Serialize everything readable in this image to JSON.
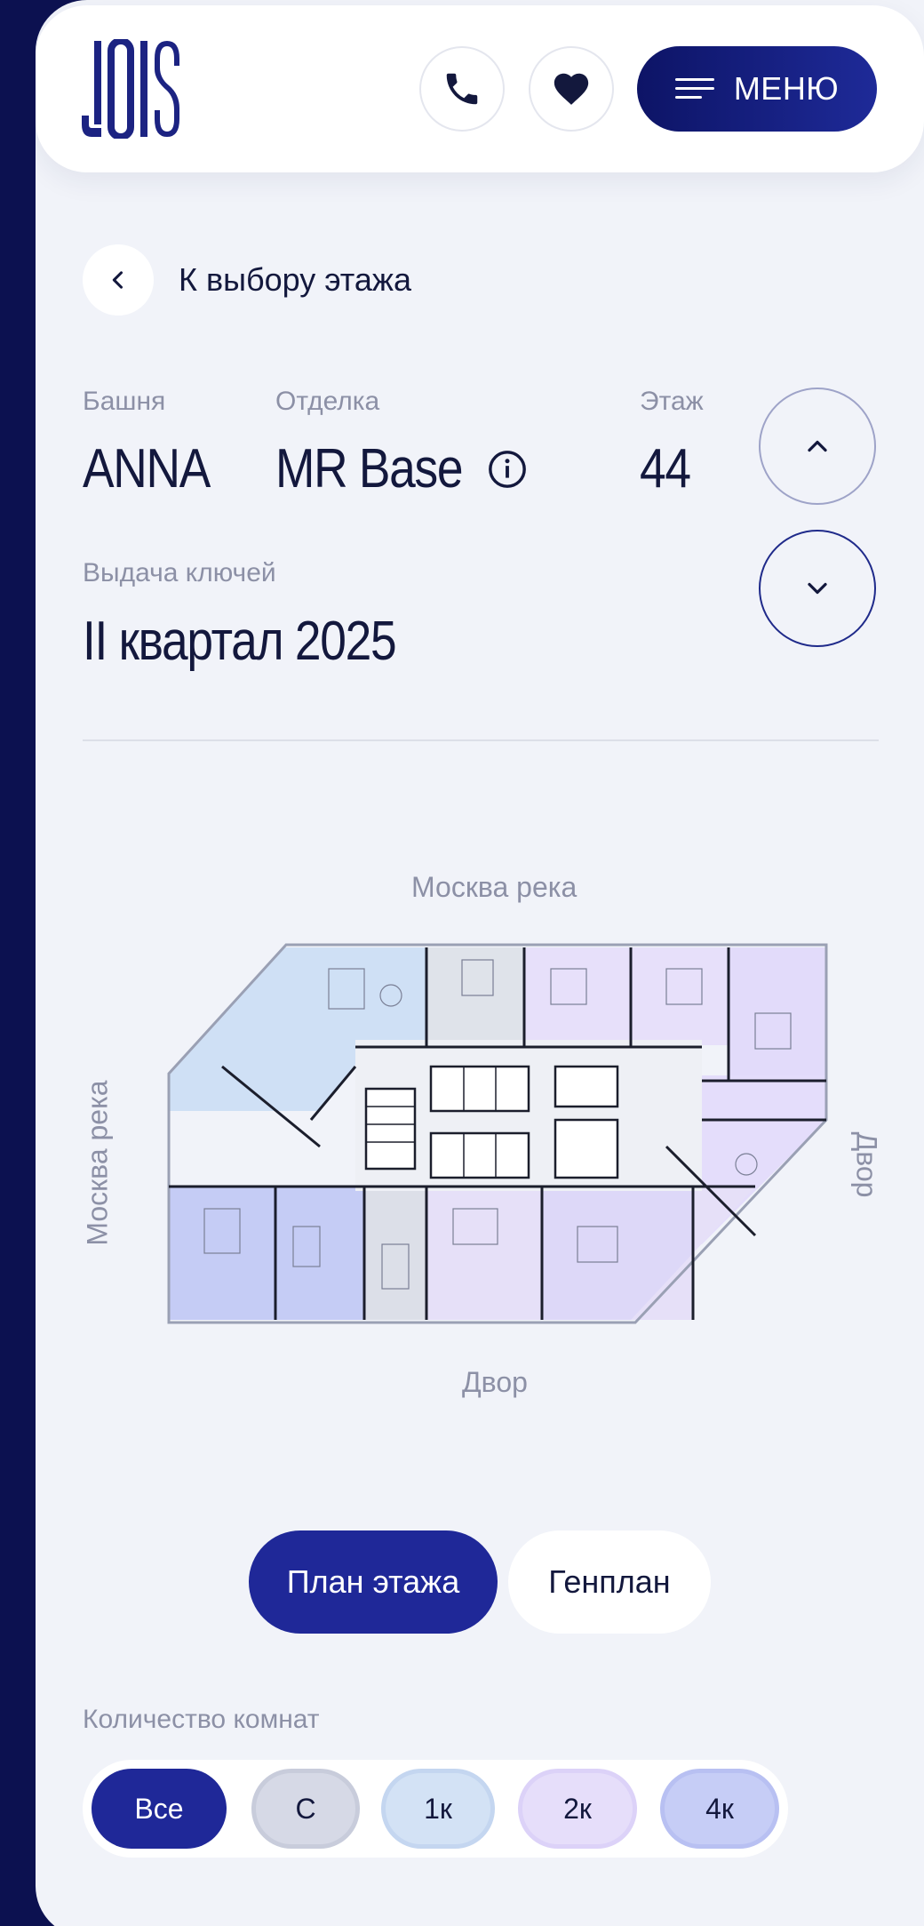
{
  "header": {
    "logo_text": "JOIS",
    "phone_icon": "phone-icon",
    "favorite_icon": "heart-icon",
    "menu_label": "МЕНЮ"
  },
  "back": {
    "label": "К выбору этажа",
    "icon": "chevron-left-icon"
  },
  "info": {
    "tower_label": "Башня",
    "tower_value": "ANNA",
    "finish_label": "Отделка",
    "finish_value": "MR Base",
    "floor_label": "Этаж",
    "floor_value": "44",
    "keys_label": "Выдача ключей",
    "keys_value": "II квартал 2025"
  },
  "plan": {
    "top": "Москва река",
    "left": "Москва река",
    "right": "Двор",
    "bottom": "Двор"
  },
  "toggle": {
    "floor_plan": "План этажа",
    "master_plan": "Генплан",
    "active": "floor_plan"
  },
  "rooms": {
    "label": "Количество комнат",
    "chips": [
      "Все",
      "С",
      "1к",
      "2к",
      "4к"
    ],
    "active": "Все"
  },
  "colors": {
    "accent": "#1f2898",
    "studio": "#d6d9e6",
    "one_room": "#d3e2f5",
    "two_room": "#e6defa",
    "four_room": "#c6cdf6"
  }
}
